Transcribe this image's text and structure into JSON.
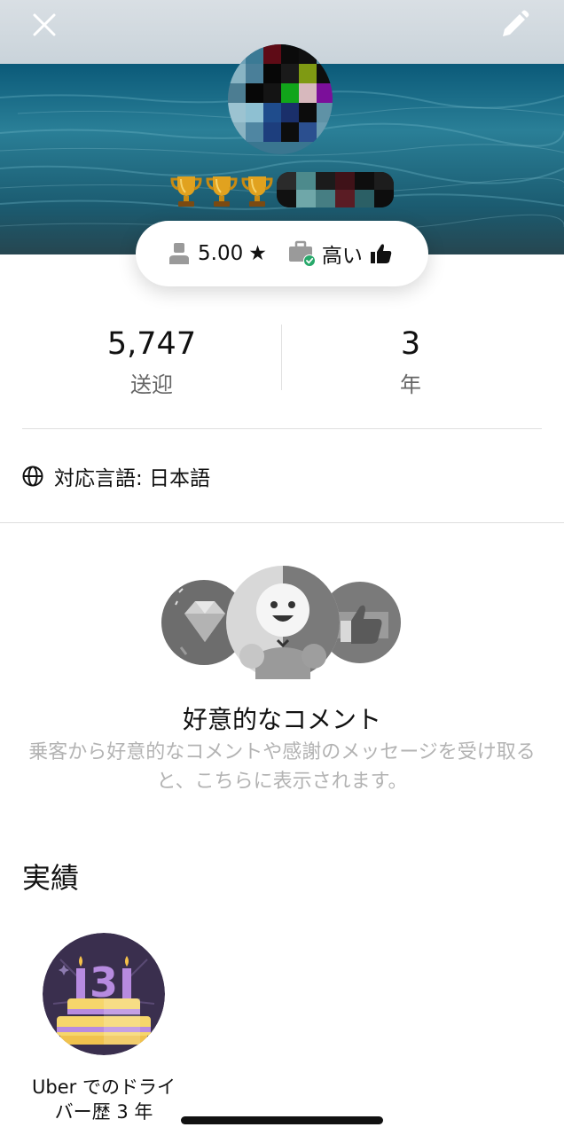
{
  "header": {
    "close_icon": "close-icon",
    "edit_icon": "pencil-icon",
    "trophy_icon": "trophy-icon",
    "trophy_count": 3
  },
  "rating_pill": {
    "rating": "5.00",
    "star": "★",
    "acceptance_label": "高い",
    "person_icon": "person-icon",
    "briefcase_icon": "briefcase-check-icon",
    "thumb_icon": "thumbs-up-icon"
  },
  "stats": {
    "trips_value": "5,747",
    "trips_label": "送迎",
    "years_value": "3",
    "years_label": "年"
  },
  "languages": {
    "icon": "globe-icon",
    "text": "対応言語: 日本語"
  },
  "compliments": {
    "title": "好意的なコメント",
    "description": "乗客から好意的なコメントや感謝のメッセージを受け取ると、こちらに表示されます。",
    "badge_icons": [
      "diamond-icon",
      "smiley-icon",
      "thumbs-up-icon"
    ]
  },
  "achievements": {
    "title": "実績",
    "items": [
      {
        "label": "Uber でのドライバー歴 3 年",
        "icon": "birthday-cake-3-icon",
        "number": "3"
      }
    ]
  },
  "colors": {
    "sea_dark": "#0e4a63",
    "sea_light": "#2d7f96",
    "badge_bg": "#3a2f4e",
    "cake_yellow": "#f6d66b",
    "candle_purple": "#b78be0",
    "check_green": "#27a86a"
  }
}
